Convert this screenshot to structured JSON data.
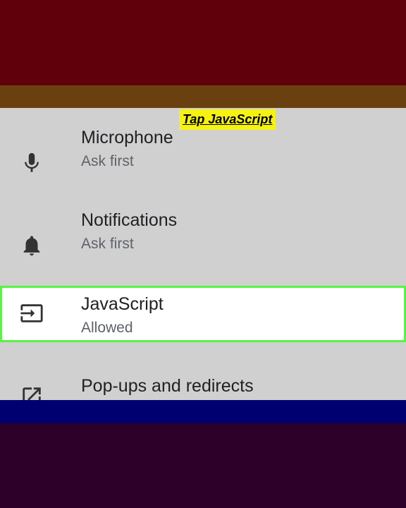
{
  "caption": "Tap JavaScript",
  "settings": [
    {
      "title": "Microphone",
      "subtitle": "Ask first",
      "icon": "microphone-icon"
    },
    {
      "title": "Notifications",
      "subtitle": "Ask first",
      "icon": "bell-icon"
    },
    {
      "title": "JavaScript",
      "subtitle": "Allowed",
      "icon": "input-arrow-icon"
    },
    {
      "title": "Pop-ups and redirects",
      "subtitle": "",
      "icon": "external-link-icon"
    }
  ],
  "colors": {
    "highlight_border": "#55f542",
    "caption_bg": "#f6f20f",
    "panel_bg": "#d0d0d0"
  }
}
